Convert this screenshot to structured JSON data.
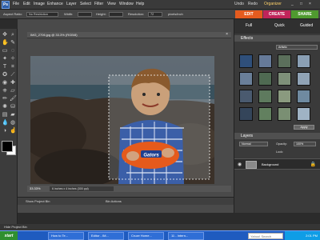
{
  "menu": {
    "logo": "Ps",
    "items": [
      "File",
      "Edit",
      "Image",
      "Enhance",
      "Layer",
      "Select",
      "Filter",
      "View",
      "Window",
      "Help"
    ],
    "undo": "Undo",
    "redo": "Redo",
    "create": "Organizer"
  },
  "options": {
    "aspect_label": "Aspect Ratio:",
    "aspect_value": "No Restriction",
    "width_label": "Width:",
    "height_label": "Height:",
    "resolution_label": "Resolution:",
    "resolution_value": "72",
    "units": "pixels/inch"
  },
  "modes": {
    "edit": "EDIT",
    "create": "CREATE",
    "share": "SHARE"
  },
  "document": {
    "title": "IMG_2706.jpg @ 33.3% (RGB/8)",
    "zoom": "33.33%",
    "size": "6 inches x 4 inches (300 ppi)"
  },
  "edit_tabs": [
    "Full",
    "Quick",
    "Guided"
  ],
  "effects": {
    "header": "Effects",
    "filter_dropdown": "Artistic",
    "apply": "Apply"
  },
  "layers": {
    "header": "Layers",
    "normal": "Normal",
    "opacity_label": "Opacity:",
    "opacity_value": "100%",
    "lock_label": "Lock:",
    "layer_name": "Background"
  },
  "bottom": {
    "project_bin": "Show Project Bin",
    "bin_actions": "Bin Actions",
    "hide_bin": "Hide Project Bin"
  },
  "taskbar": {
    "start": "start",
    "tasks": [
      "How to Te...",
      "Editor - IM...",
      "Cruze Home...",
      "11 - Intern..."
    ],
    "search_placeholder": "Yahoo! Search",
    "clock": "2:01 PM"
  },
  "colors": {
    "edit_tab": "#e55b1e",
    "create_tab": "#c0245a",
    "share_tab": "#4f9a2f"
  }
}
